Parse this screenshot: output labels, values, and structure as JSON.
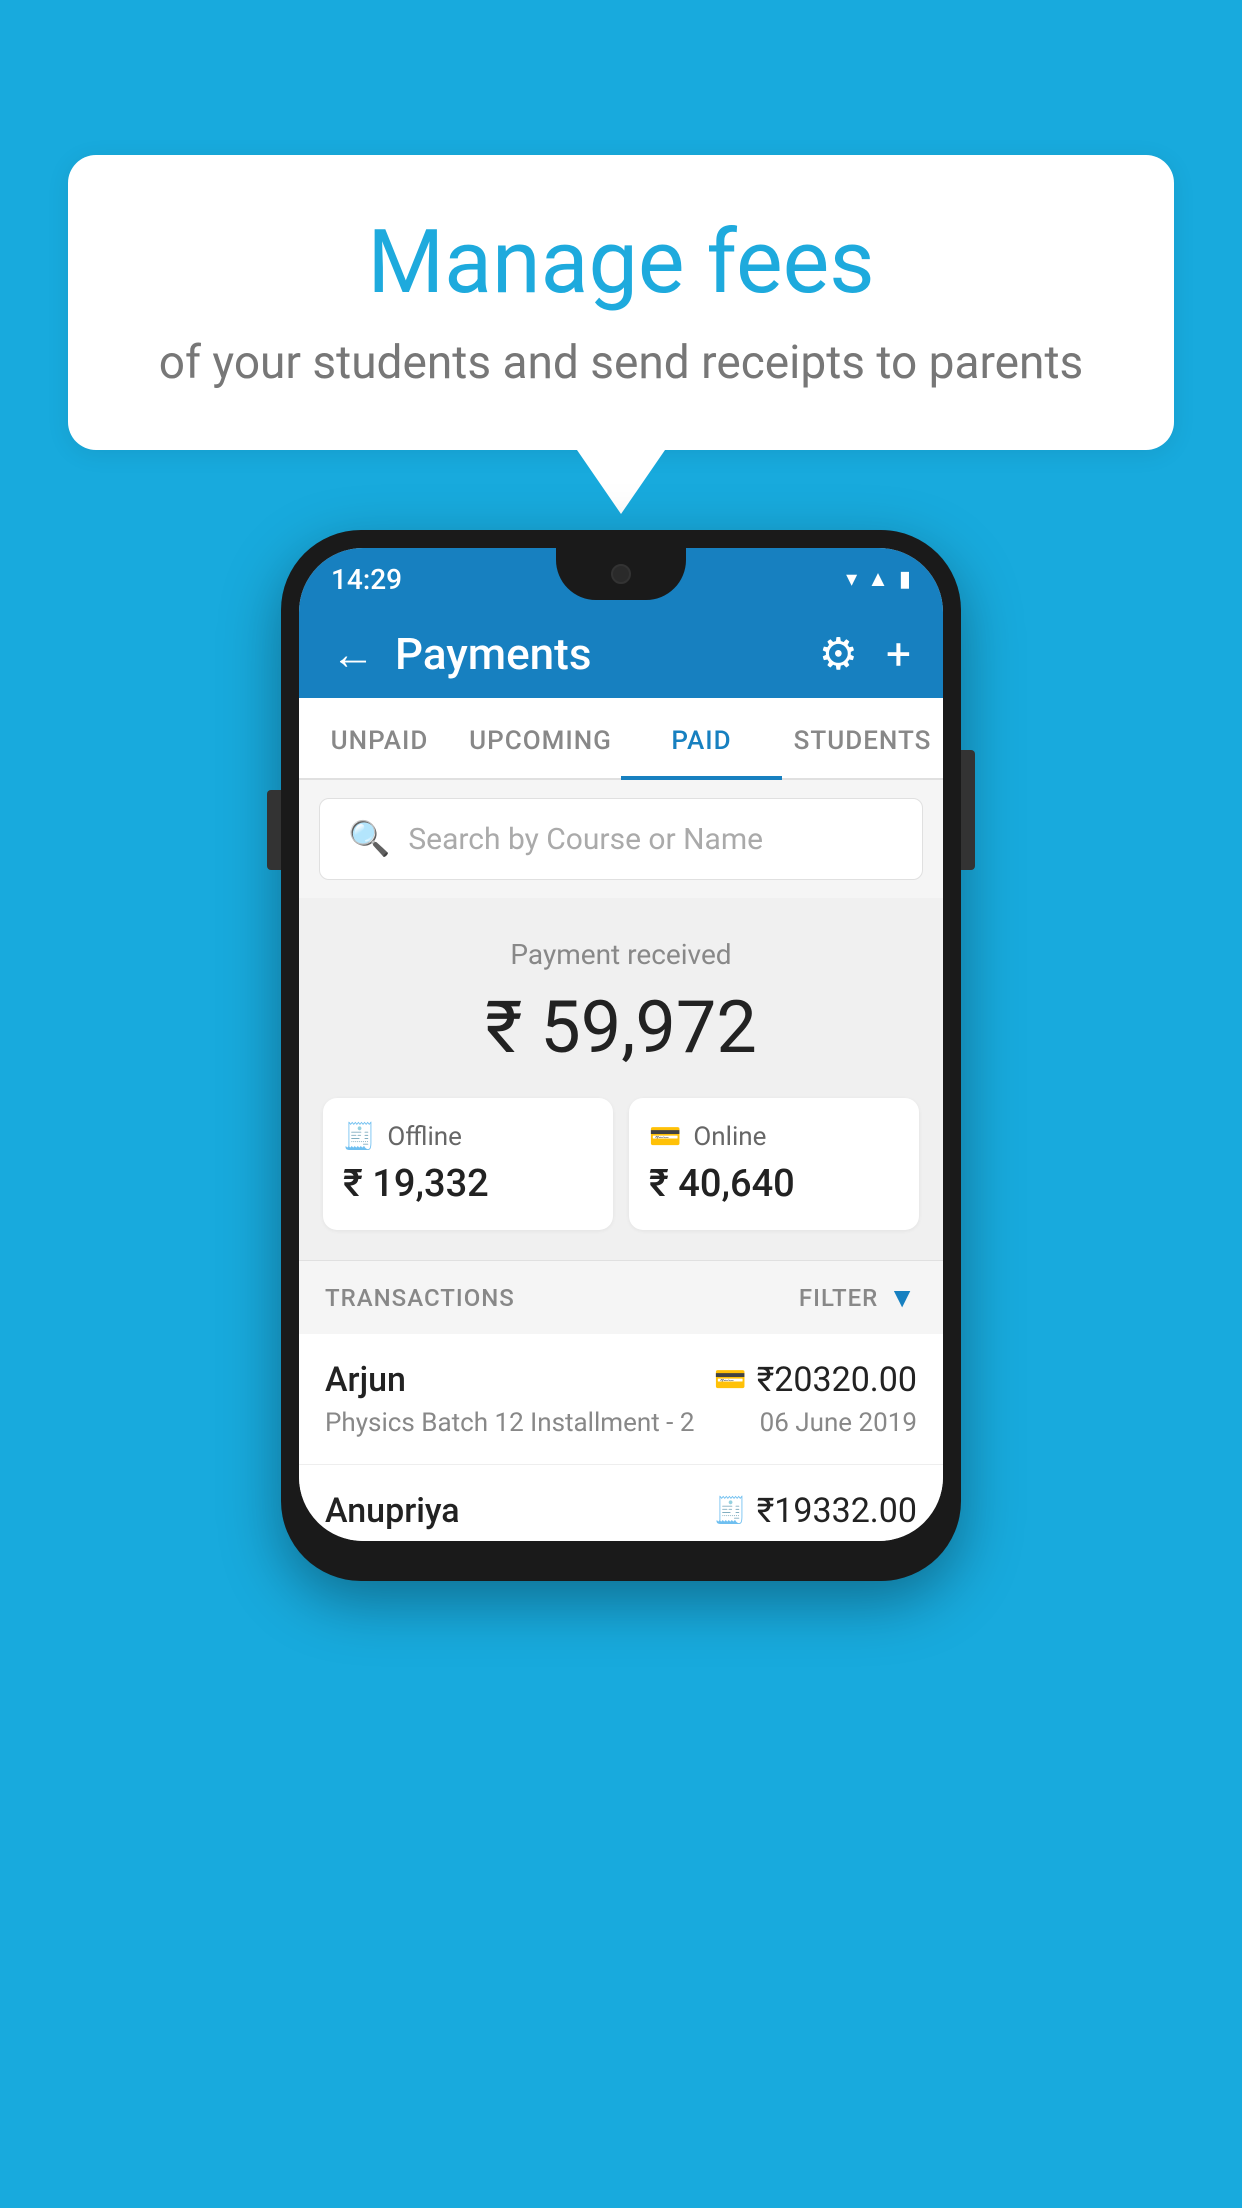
{
  "background_color": "#18aadd",
  "bubble": {
    "title": "Manage fees",
    "subtitle": "of your students and send receipts to parents"
  },
  "status_bar": {
    "time": "14:29",
    "icons": [
      "wifi",
      "signal",
      "battery"
    ]
  },
  "header": {
    "title": "Payments",
    "back_label": "←",
    "settings_label": "⚙",
    "add_label": "+"
  },
  "tabs": [
    {
      "label": "UNPAID",
      "active": false
    },
    {
      "label": "UPCOMING",
      "active": false
    },
    {
      "label": "PAID",
      "active": true
    },
    {
      "label": "STUDENTS",
      "active": false
    }
  ],
  "search": {
    "placeholder": "Search by Course or Name"
  },
  "payment_summary": {
    "label": "Payment received",
    "amount": "₹ 59,972",
    "offline": {
      "label": "Offline",
      "amount": "₹ 19,332"
    },
    "online": {
      "label": "Online",
      "amount": "₹ 40,640"
    }
  },
  "transactions": {
    "label": "TRANSACTIONS",
    "filter_label": "FILTER",
    "rows": [
      {
        "name": "Arjun",
        "amount": "₹20320.00",
        "course": "Physics Batch 12 Installment - 2",
        "date": "06 June 2019",
        "payment_type": "online"
      },
      {
        "name": "Anupriya",
        "amount": "₹19332.00",
        "course": "",
        "date": "",
        "payment_type": "offline"
      }
    ]
  }
}
